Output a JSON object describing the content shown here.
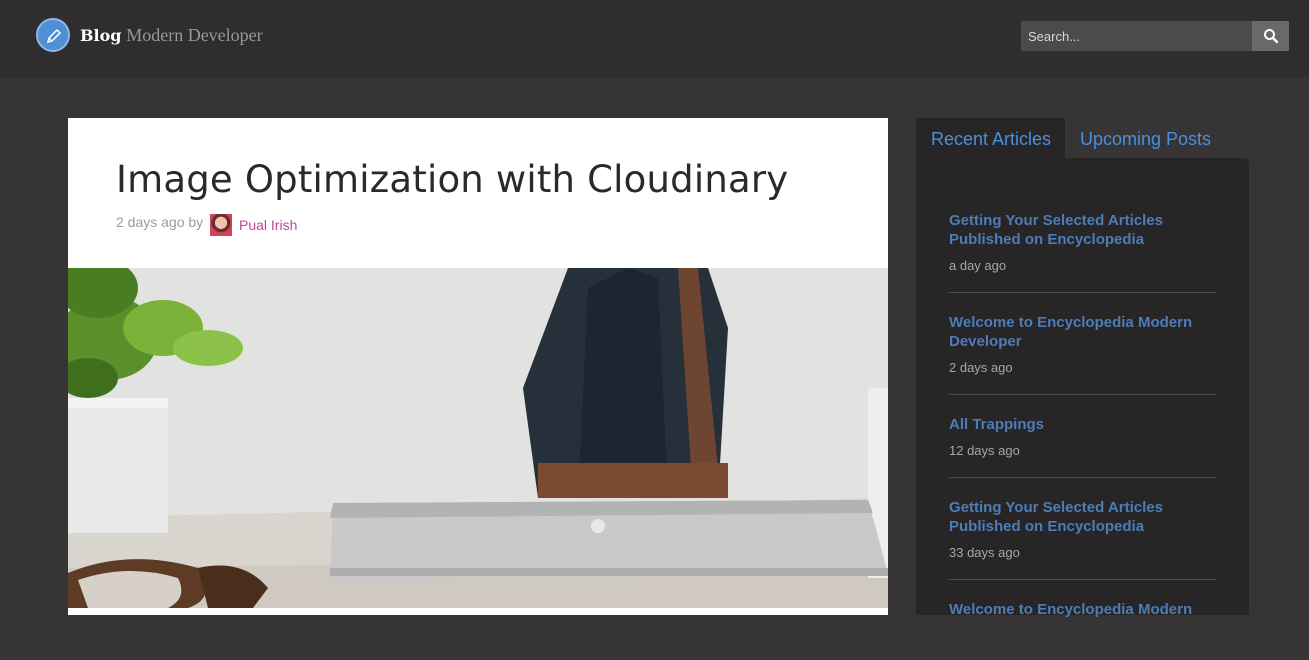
{
  "header": {
    "brand_main": "Blog",
    "brand_sub": "Modern Developer",
    "logo_icon": "pencil-icon",
    "search": {
      "placeholder": "Search...",
      "value": "",
      "icon": "search-icon"
    }
  },
  "article": {
    "title": "Image Optimization with Cloudinary",
    "meta_prefix": "2 days ago by",
    "author": "Pual Irish",
    "hero_image": "laptop-desk-photo"
  },
  "sidebar": {
    "tabs": [
      {
        "label": "Recent Articles",
        "active": true
      },
      {
        "label": "Upcoming Posts",
        "active": false
      }
    ],
    "items": [
      {
        "title": "Getting Your Selected Articles Published on Encyclopedia",
        "time": "a day ago"
      },
      {
        "title": "Welcome to Encyclopedia Modern Developer",
        "time": "2 days ago"
      },
      {
        "title": "All Trappings",
        "time": "12 days ago"
      },
      {
        "title": "Getting Your Selected Articles Published on Encyclopedia",
        "time": "33 days ago"
      },
      {
        "title": "Welcome to Encyclopedia Modern",
        "time": ""
      }
    ]
  },
  "colors": {
    "page_bg": "#363435",
    "header_bg": "#2f2d2e",
    "tab_blue": "#4a8fe0",
    "link_blue": "#4c7db8",
    "author_pink": "#c2479a"
  }
}
